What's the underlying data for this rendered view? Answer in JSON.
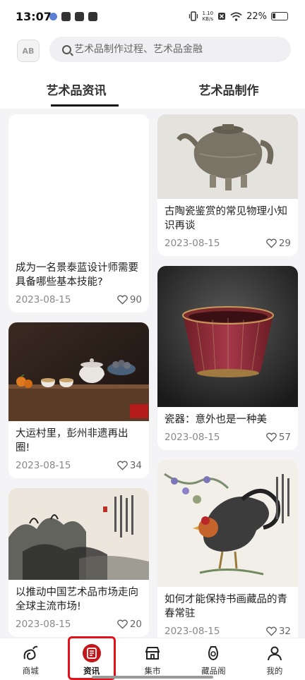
{
  "status_bar": {
    "time": "13:07",
    "speed_value": "1.10",
    "speed_unit": "KB/s",
    "battery": "22%"
  },
  "header": {
    "logo_text": "AB",
    "search": {
      "placeholder": "艺术品制作过程、艺术品金融"
    }
  },
  "tabs": [
    {
      "label": "艺术品资讯",
      "active": true
    },
    {
      "label": "艺术品制作",
      "active": false
    }
  ],
  "feed": {
    "left": [
      {
        "title": "成为一名景泰蓝设计师需要具备哪些基本技能?",
        "date": "2023-08-15",
        "likes": "90",
        "image": "blank"
      },
      {
        "title": "大运村里，彭州非遗再出圈!",
        "date": "2023-08-15",
        "likes": "34",
        "image": "tea-set"
      },
      {
        "title": "以推动中国艺术品市场走向全球主流市场!",
        "date": "2023-08-15",
        "likes": "20",
        "image": "ink-landscape"
      }
    ],
    "right": [
      {
        "title": "古陶瓷鉴赏的常见物理小知识再谈",
        "date": "2023-08-15",
        "likes": "29",
        "image": "ancient-pot"
      },
      {
        "title": "瓷器：意外也是一种美",
        "date": "2023-08-15",
        "likes": "57",
        "image": "red-bowl"
      },
      {
        "title": "如何才能保持书画藏品的青春常驻",
        "date": "2023-08-15",
        "likes": "32",
        "image": "rooster-painting"
      }
    ]
  },
  "tab_bar": [
    {
      "label": "商城",
      "icon": "mall-icon",
      "active": false
    },
    {
      "label": "资讯",
      "icon": "news-icon",
      "active": true
    },
    {
      "label": "集市",
      "icon": "market-icon",
      "active": false
    },
    {
      "label": "藏品阁",
      "icon": "collection-icon",
      "active": false
    },
    {
      "label": "我的",
      "icon": "profile-icon",
      "active": false
    }
  ],
  "colors": {
    "accent": "#c2161b",
    "highlight_box": "#e0131a",
    "background": "#f4f4f6"
  }
}
